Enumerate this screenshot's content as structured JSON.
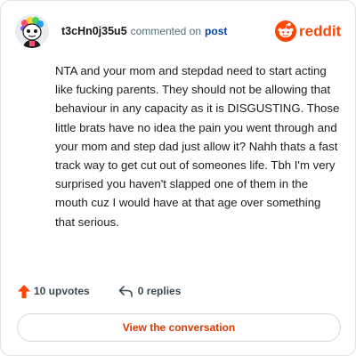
{
  "header": {
    "username": "t3cHn0j35u5",
    "action_text": "commented on",
    "post_link": "post",
    "brand": "reddit"
  },
  "icons": {
    "avatar": "avatar-icon",
    "brand": "reddit-logo-icon",
    "upvote": "upvote-arrow-icon",
    "reply": "reply-icon"
  },
  "comment": {
    "body": "NTA and your mom and stepdad need to start acting like fucking parents. They should not be allowing that behaviour in any capacity as it is DISGUSTING. Those little brats have no idea the pain you went through and your mom and step dad just allow it? Nahh thats a fast track way to get cut out of someones life. Tbh I'm very surprised you haven't slapped one of them in the mouth cuz I would have at that age over something that serious."
  },
  "actions": {
    "upvotes": "10 upvotes",
    "replies": "0 replies"
  },
  "cta": {
    "label": "View the conversation"
  },
  "colors": {
    "brand_orange": "#ff4500",
    "link_blue": "#0045ac",
    "cta_text": "#d93a00"
  }
}
